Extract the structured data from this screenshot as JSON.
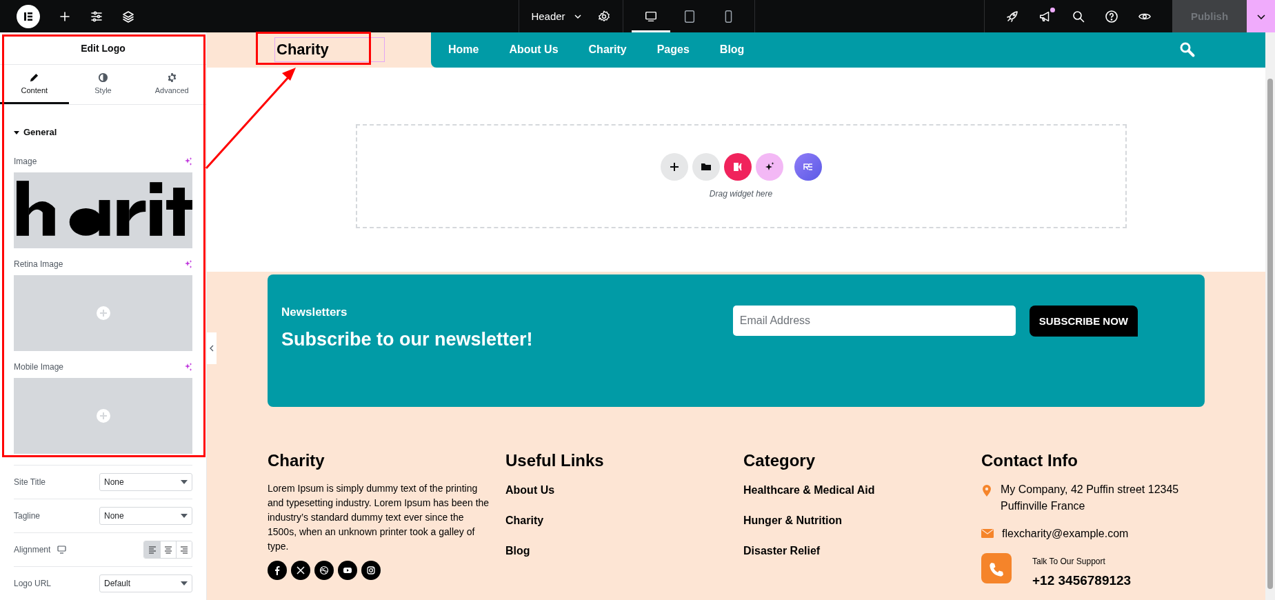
{
  "topbar": {
    "document": "Header",
    "devices": [
      {
        "kind": "desktop",
        "selected": true
      },
      {
        "kind": "tablet",
        "selected": false
      },
      {
        "kind": "mobile",
        "selected": false
      }
    ],
    "notification": true,
    "publish": {
      "label": "Publish",
      "disabled": true
    }
  },
  "panel": {
    "title": "Edit Logo",
    "tabs": [
      {
        "label": "Content",
        "kind": "pencil",
        "selected": true
      },
      {
        "label": "Style",
        "kind": "contrast",
        "selected": false
      },
      {
        "label": "Advanced",
        "kind": "gear",
        "selected": false
      }
    ],
    "section": {
      "title": "General",
      "expanded": true
    },
    "image_fields": [
      {
        "label": "Image",
        "has_image": true
      },
      {
        "label": "Retina Image",
        "has_image": false
      },
      {
        "label": "Mobile Image",
        "has_image": false
      }
    ],
    "settings": [
      {
        "label": "Site Title",
        "value": "None"
      },
      {
        "label": "Tagline",
        "value": "None"
      }
    ],
    "alignment": {
      "label": "Alignment",
      "options": [
        {
          "kind": "left",
          "selected": true
        },
        {
          "kind": "center",
          "selected": false
        },
        {
          "kind": "right",
          "selected": false
        }
      ]
    },
    "logo_url": {
      "label": "Logo URL",
      "value": "Default"
    }
  },
  "canvas": {
    "header": {
      "logo": "Charity",
      "nav": [
        {
          "label": "Home"
        },
        {
          "label": "About Us"
        },
        {
          "label": "Charity"
        },
        {
          "label": "Pages"
        },
        {
          "label": "Blog"
        }
      ]
    },
    "dropzone": {
      "hint": "Drag widget here"
    },
    "newsletter": {
      "eyebrow": "Newsletters",
      "title": "Subscribe to our newsletter!",
      "placeholder": "Email Address",
      "button": "SUBSCRIBE NOW"
    },
    "footer": {
      "about": {
        "title": "Charity",
        "text": "Lorem Ipsum is simply dummy text of the printing and typesetting industry. Lorem Ipsum has been the industry’s standard dummy text ever since the 1500s, when an unknown printer took a galley of type."
      },
      "columns": [
        {
          "title": "Useful Links",
          "links": [
            "About Us",
            "Charity",
            "Blog"
          ]
        },
        {
          "title": "Category",
          "links": [
            "Healthcare & Medical Aid",
            "Hunger & Nutrition",
            "Disaster Relief"
          ]
        }
      ],
      "contact": {
        "title": "Contact Info",
        "address": "My Company, 42 Puffin street 12345 Puffinville France",
        "email": "flexcharity@example.com",
        "support_label": "Talk To Our Support",
        "phone": "+12 3456789123"
      }
    }
  }
}
